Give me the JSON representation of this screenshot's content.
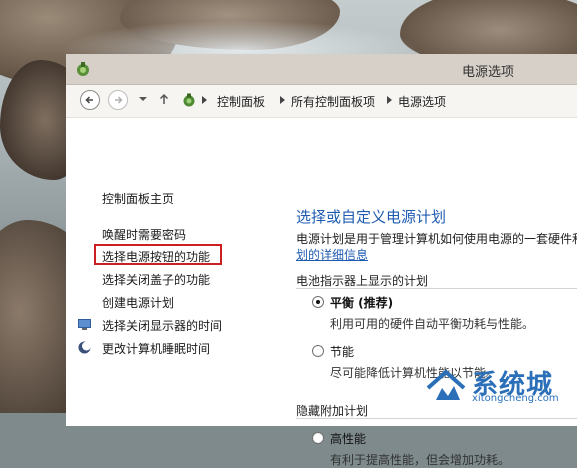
{
  "window": {
    "title": "电源选项"
  },
  "breadcrumb": {
    "items": [
      "控制面板",
      "所有控制面板项",
      "电源选项"
    ]
  },
  "sidebar": {
    "home": "控制面板主页",
    "links": [
      "唤醒时需要密码",
      "选择电源按钮的功能",
      "选择关闭盖子的功能",
      "创建电源计划",
      "选择关闭显示器的时间",
      "更改计算机睡眠时间"
    ]
  },
  "main": {
    "heading": "选择或自定义电源计划",
    "description": "电源计划是用于管理计算机如何使用电源的一套硬件和",
    "description_link": "划的详细信息",
    "battery_section": "电池指示器上显示的计划",
    "plans": [
      {
        "name": "平衡 (推荐)",
        "desc": "利用可用的硬件自动平衡功耗与性能。",
        "selected": true
      },
      {
        "name": "节能",
        "desc": "尽可能降低计算机性能以节能。",
        "selected": false
      }
    ],
    "hidden_section": "隐藏附加计划",
    "hidden_plans": [
      {
        "name": "高性能",
        "desc": "有利于提高性能，但会增加功耗。",
        "selected": false
      }
    ]
  },
  "watermark": {
    "name": "系统城",
    "url": "xitongcheng.com"
  },
  "colors": {
    "link": "#1e5bb1",
    "highlight": "#cc1f1f"
  }
}
